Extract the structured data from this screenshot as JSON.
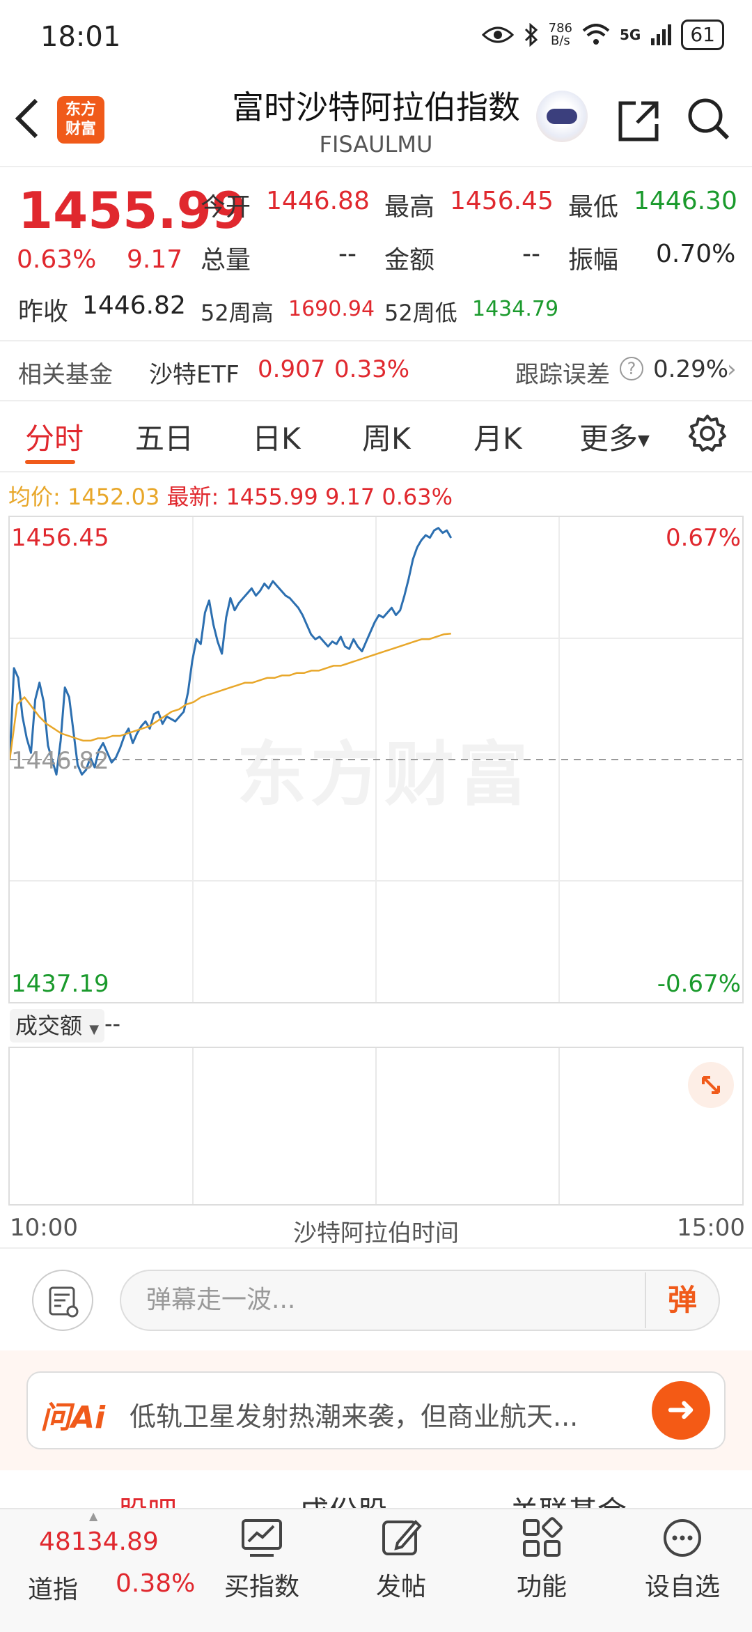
{
  "status_bar": {
    "time": "18:01",
    "net_speed": "786\nB/s",
    "signal": "5G",
    "battery": "61"
  },
  "header": {
    "title": "富时沙特阿拉伯指数",
    "code": "FISAULMU",
    "logo_text": "东方\n财富"
  },
  "quote": {
    "price": "1455.99",
    "change_pct": "0.63%",
    "change": "9.17",
    "open_label": "今开",
    "open": "1446.88",
    "high_label": "最高",
    "high": "1456.45",
    "low_label": "最低",
    "low": "1446.30",
    "volume_label": "总量",
    "volume": "--",
    "amount_label": "金额",
    "amount": "--",
    "amplitude_label": "振幅",
    "amplitude": "0.70%",
    "prev_close_label": "昨收",
    "prev_close": "1446.82",
    "wk52_high_label": "52周高",
    "wk52_high": "1690.94",
    "wk52_low_label": "52周低",
    "wk52_low": "1434.79"
  },
  "fund_row": {
    "label": "相关基金",
    "fund_name": "沙特ETF",
    "fund_price": "0.907",
    "fund_change": "0.33%",
    "tracking_label": "跟踪误差",
    "tracking_value": "0.29%"
  },
  "tabs": [
    "分时",
    "五日",
    "日K",
    "周K",
    "月K",
    "更多"
  ],
  "summary": {
    "avg_label": "均价:",
    "avg_value": "1452.03",
    "latest_label": "最新:",
    "latest_value": "1455.99",
    "change": "9.17",
    "change_pct": "0.63%"
  },
  "chart": {
    "top_price": "1456.45",
    "top_pct": "0.67%",
    "ref_price": "1446.82",
    "bottom_price": "1437.19",
    "bottom_pct": "-0.67%",
    "volume_label": "成交额",
    "volume_value": "--",
    "time_start": "10:00",
    "time_mid": "沙特阿拉伯时间",
    "time_end": "15:00",
    "watermark": "东方财富",
    "colors": {
      "price": "#2c6fb0",
      "avg": "#e8a72a",
      "up": "#e0282e",
      "down": "#1a9a2c"
    }
  },
  "chart_data": {
    "type": "line",
    "ylim": [
      1437.19,
      1456.45
    ],
    "ref": 1446.82,
    "series": [
      {
        "values": [
          1446.82,
          1450.6,
          1450.2,
          1448.6,
          1447.7,
          1447.1,
          1449.3,
          1450.0,
          1449.2,
          1447.4,
          1446.8,
          1446.2,
          1447.6,
          1449.8,
          1449.4,
          1448.0,
          1446.6,
          1446.2,
          1446.4,
          1446.9,
          1446.5,
          1447.2,
          1447.5,
          1447.1,
          1446.7,
          1446.9,
          1447.3,
          1447.8,
          1448.1,
          1447.5,
          1447.9,
          1448.2,
          1448.4,
          1448.1,
          1448.7,
          1448.8,
          1448.3,
          1448.6,
          1448.5,
          1448.4,
          1448.6,
          1448.8,
          1449.6,
          1450.9,
          1451.8,
          1451.6,
          1452.9,
          1453.4,
          1452.4,
          1451.7,
          1451.2,
          1452.7,
          1453.5,
          1453.0,
          1453.3,
          1453.5,
          1453.7,
          1453.9,
          1453.6,
          1453.8,
          1454.1,
          1453.9,
          1454.2,
          1454.0,
          1453.8,
          1453.6,
          1453.5,
          1453.3,
          1453.1,
          1452.8,
          1452.4,
          1452.0,
          1451.8,
          1451.9,
          1451.7,
          1451.5,
          1451.7,
          1451.6,
          1451.9,
          1451.5,
          1451.4,
          1451.8,
          1451.5,
          1451.3,
          1451.7,
          1452.1,
          1452.5,
          1452.8,
          1452.7,
          1452.9,
          1453.1,
          1452.8,
          1453.0,
          1453.6,
          1454.3,
          1455.1,
          1455.6,
          1455.9,
          1456.1,
          1456.0,
          1456.3,
          1456.4,
          1456.2,
          1456.3,
          1455.99
        ]
      },
      {
        "values": [
          1446.82,
          1449.1,
          1449.4,
          1449.0,
          1448.6,
          1448.3,
          1448.1,
          1447.9,
          1447.8,
          1447.7,
          1447.6,
          1447.6,
          1447.7,
          1447.7,
          1447.8,
          1447.8,
          1447.9,
          1448.0,
          1448.1,
          1448.2,
          1448.4,
          1448.6,
          1448.8,
          1448.9,
          1449.1,
          1449.2,
          1449.4,
          1449.5,
          1449.6,
          1449.7,
          1449.8,
          1449.9,
          1450.0,
          1450.0,
          1450.1,
          1450.2,
          1450.2,
          1450.3,
          1450.3,
          1450.4,
          1450.4,
          1450.5,
          1450.5,
          1450.6,
          1450.7,
          1450.7,
          1450.8,
          1450.9,
          1451.0,
          1451.1,
          1451.2,
          1451.3,
          1451.4,
          1451.5,
          1451.6,
          1451.7,
          1451.8,
          1451.8,
          1451.9,
          1452.0,
          1452.03
        ]
      }
    ]
  },
  "barrage": {
    "placeholder": "弹幕走一波...",
    "button": "弹"
  },
  "ai": {
    "logo": "问Ai",
    "text": "低轨卫星发射热潮来袭，但商业航天..."
  },
  "sub_tabs": [
    "股吧",
    "成份股",
    "关联基金"
  ],
  "nav": {
    "dow_value": "48134.89",
    "dow_label": "道指",
    "dow_pct": "0.38%",
    "items": [
      "买指数",
      "发帖",
      "功能",
      "设自选"
    ]
  }
}
